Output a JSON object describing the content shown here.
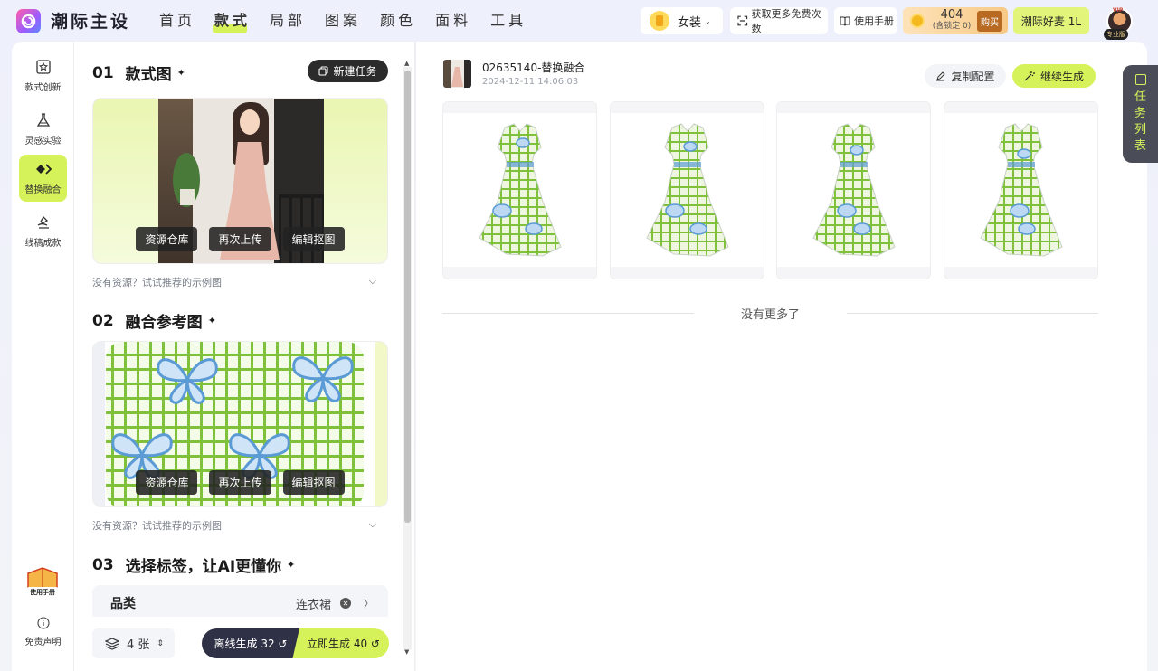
{
  "brand": {
    "name": "潮际主设"
  },
  "nav": {
    "items": [
      "首页",
      "款式",
      "局部",
      "图案",
      "颜色",
      "面料",
      "工具"
    ],
    "active": "款式"
  },
  "topbar": {
    "category": "女装",
    "free_times": "获取更多免费次数",
    "manual": "使用手册",
    "coins": "404",
    "coins_locked": "(含锁定 0)",
    "buy": "购买",
    "promo": "潮际好麦 1L",
    "vip": "VIP",
    "pro": "专业版"
  },
  "sidenav": {
    "items": [
      {
        "label": "款式创新",
        "icon": "star-frame-icon"
      },
      {
        "label": "灵感实验",
        "icon": "flask-icon"
      },
      {
        "label": "替换融合",
        "icon": "diamond-swap-icon"
      },
      {
        "label": "线稿成款",
        "icon": "sketch-icon"
      }
    ],
    "active": "替换融合",
    "manual": "使用手册",
    "disclaimer": "免责声明"
  },
  "left": {
    "s1_num": "01",
    "s1_title": "款式图",
    "new_task": "新建任务",
    "btn_repo": "资源仓库",
    "btn_reupload": "再次上传",
    "btn_edit": "编辑抠图",
    "hint": "没有资源？试试推荐的示例图",
    "s2_num": "02",
    "s2_title": "融合参考图",
    "s3_num": "03",
    "s3_title": "选择标签，让AI更懂你",
    "tag_label": "品类",
    "tag_value": "连衣裙",
    "count": "4 张",
    "gen_offline": "离线生成 32",
    "gen_now": "立即生成 40"
  },
  "main": {
    "task_id": "02635140-替换融合",
    "task_time": "2024-12-11 14:06:03",
    "copy_config": "复制配置",
    "continue_gen": "继续生成",
    "results": 4,
    "no_more": "没有更多了"
  },
  "task_tab": {
    "chars": [
      "任",
      "务",
      "列",
      "表"
    ]
  },
  "colors": {
    "accent": "#d6f25a",
    "dark": "#2b2b2b",
    "pattern_green": "#7fc13b",
    "pattern_blue": "#5b9bd5"
  }
}
